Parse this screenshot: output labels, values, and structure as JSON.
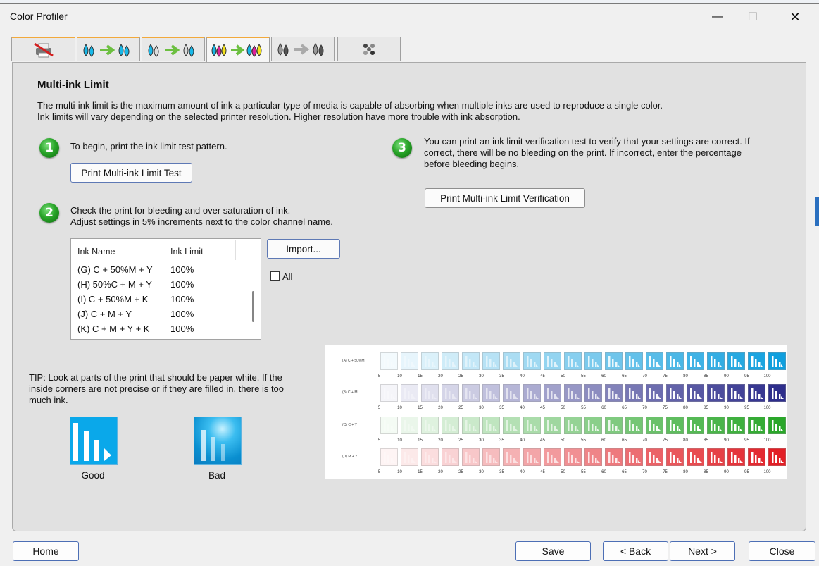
{
  "window": {
    "title": "Color Profiler",
    "minimize": "—",
    "maximize": "☐",
    "close": "✕"
  },
  "tabs": [
    {
      "icon": "printer-icon"
    },
    {
      "icon": "cyan-to-cyan-icon"
    },
    {
      "icon": "cyan-to-gray-icon"
    },
    {
      "icon": "cmy-to-cmy-icon"
    },
    {
      "icon": "gray-to-gray-icon"
    },
    {
      "icon": "pattern-icon"
    }
  ],
  "page": {
    "title": "Multi-ink Limit",
    "description_line1": "The multi-ink limit is the maximum amount of ink a particular type of media is capable of absorbing when multiple inks are used to reproduce a single color.",
    "description_line2": "Ink limits will vary depending on the selected printer resolution. Higher resolution have more trouble with ink absorption."
  },
  "step1": {
    "number": "1",
    "text": "To begin, print the ink limit test pattern.",
    "button": "Print Multi-ink Limit Test"
  },
  "step2": {
    "number": "2",
    "text_line1": "Check the print for bleeding and over saturation of ink.",
    "text_line2": "Adjust settings in 5% increments next to the color channel name.",
    "table": {
      "col_name": "Ink Name",
      "col_limit": "Ink Limit",
      "rows": [
        {
          "name": "(G) C + 50%M + Y",
          "limit": "100%"
        },
        {
          "name": "(H) 50%C + M + Y",
          "limit": "100%"
        },
        {
          "name": "(I) C + 50%M + K",
          "limit": "100%"
        },
        {
          "name": "(J) C + M + Y",
          "limit": "100%"
        },
        {
          "name": "(K) C + M + Y + K",
          "limit": "100%"
        }
      ]
    },
    "import_button": "Import...",
    "all_label": "All",
    "all_checked": false
  },
  "step3": {
    "number": "3",
    "text_line1": "You can print an ink limit verification test to verify that your settings are correct. If",
    "text_line2": "correct, there will be no bleeding on the print. If incorrect, enter the percentage",
    "text_line3": "before bleeding begins.",
    "button": "Print Multi-ink Limit Verification"
  },
  "tip": {
    "line1": "TIP: Look at parts of the print that should be paper white. If the",
    "line2": "inside corners are not precise or if they are filled in, there is too",
    "line3": "much ink.",
    "good_label": "Good",
    "bad_label": "Bad"
  },
  "pattern": {
    "steps": [
      "5",
      "10",
      "15",
      "20",
      "25",
      "30",
      "35",
      "40",
      "45",
      "50",
      "55",
      "60",
      "65",
      "70",
      "75",
      "80",
      "85",
      "90",
      "95",
      "100"
    ],
    "rows": [
      {
        "label": "(A) C + 50%M",
        "color": "#0f9fde"
      },
      {
        "label": "(B) C + M",
        "color": "#2e2e8c"
      },
      {
        "label": "(C) C + Y",
        "color": "#2aa72a"
      },
      {
        "label": "(D) M + Y",
        "color": "#e21f26"
      }
    ]
  },
  "footer": {
    "home": "Home",
    "save": "Save",
    "back": "< Back",
    "next": "Next >",
    "close": "Close"
  }
}
